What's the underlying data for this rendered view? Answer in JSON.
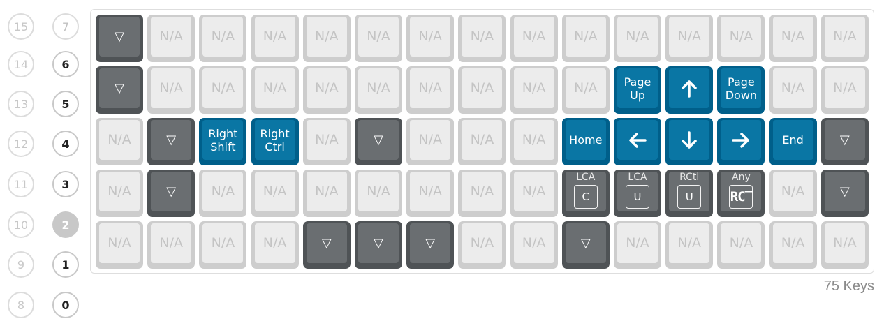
{
  "layers_left": [
    {
      "label": "15",
      "state": "inactive"
    },
    {
      "label": "14",
      "state": "inactive"
    },
    {
      "label": "13",
      "state": "inactive"
    },
    {
      "label": "12",
      "state": "inactive"
    },
    {
      "label": "11",
      "state": "inactive"
    },
    {
      "label": "10",
      "state": "inactive"
    },
    {
      "label": "9",
      "state": "inactive"
    },
    {
      "label": "8",
      "state": "inactive"
    }
  ],
  "layers_right": [
    {
      "label": "7",
      "state": "empty"
    },
    {
      "label": "6",
      "state": "used"
    },
    {
      "label": "5",
      "state": "used"
    },
    {
      "label": "4",
      "state": "used"
    },
    {
      "label": "3",
      "state": "used"
    },
    {
      "label": "2",
      "state": "active"
    },
    {
      "label": "1",
      "state": "used"
    },
    {
      "label": "0",
      "state": "used"
    }
  ],
  "keyboard": {
    "rows": [
      [
        {
          "type": "trans",
          "label": "▽"
        },
        {
          "type": "na",
          "label": "N/A"
        },
        {
          "type": "na",
          "label": "N/A"
        },
        {
          "type": "na",
          "label": "N/A"
        },
        {
          "type": "na",
          "label": "N/A"
        },
        {
          "type": "na",
          "label": "N/A"
        },
        {
          "type": "na",
          "label": "N/A"
        },
        {
          "type": "na",
          "label": "N/A"
        },
        {
          "type": "na",
          "label": "N/A"
        },
        {
          "type": "na",
          "label": "N/A"
        },
        {
          "type": "na",
          "label": "N/A"
        },
        {
          "type": "na",
          "label": "N/A"
        },
        {
          "type": "na",
          "label": "N/A"
        },
        {
          "type": "na",
          "label": "N/A"
        },
        {
          "type": "na",
          "label": "N/A"
        }
      ],
      [
        {
          "type": "trans",
          "label": "▽"
        },
        {
          "type": "na",
          "label": "N/A"
        },
        {
          "type": "na",
          "label": "N/A"
        },
        {
          "type": "na",
          "label": "N/A"
        },
        {
          "type": "na",
          "label": "N/A"
        },
        {
          "type": "na",
          "label": "N/A"
        },
        {
          "type": "na",
          "label": "N/A"
        },
        {
          "type": "na",
          "label": "N/A"
        },
        {
          "type": "na",
          "label": "N/A"
        },
        {
          "type": "na",
          "label": "N/A"
        },
        {
          "type": "blue",
          "lines": [
            "Page",
            "Up"
          ]
        },
        {
          "type": "arrow",
          "icon": "arrow-up-icon"
        },
        {
          "type": "blue",
          "lines": [
            "Page",
            "Down"
          ]
        },
        {
          "type": "na",
          "label": "N/A"
        },
        {
          "type": "na",
          "label": "N/A"
        }
      ],
      [
        {
          "type": "na",
          "label": "N/A"
        },
        {
          "type": "trans",
          "label": "▽"
        },
        {
          "type": "blue",
          "lines": [
            "Right",
            "Shift"
          ]
        },
        {
          "type": "blue",
          "lines": [
            "Right",
            "Ctrl"
          ]
        },
        {
          "type": "na",
          "label": "N/A"
        },
        {
          "type": "trans",
          "label": "▽"
        },
        {
          "type": "na",
          "label": "N/A"
        },
        {
          "type": "na",
          "label": "N/A"
        },
        {
          "type": "na",
          "label": "N/A"
        },
        {
          "type": "blue",
          "lines": [
            "Home"
          ]
        },
        {
          "type": "arrow",
          "icon": "arrow-left-icon"
        },
        {
          "type": "arrow",
          "icon": "arrow-down-icon"
        },
        {
          "type": "arrow",
          "icon": "arrow-right-icon"
        },
        {
          "type": "blue",
          "lines": [
            "End"
          ]
        },
        {
          "type": "trans",
          "label": "▽"
        }
      ],
      [
        {
          "type": "na",
          "label": "N/A"
        },
        {
          "type": "trans",
          "label": "▽"
        },
        {
          "type": "na",
          "label": "N/A"
        },
        {
          "type": "na",
          "label": "N/A"
        },
        {
          "type": "na",
          "label": "N/A"
        },
        {
          "type": "na",
          "label": "N/A"
        },
        {
          "type": "na",
          "label": "N/A"
        },
        {
          "type": "na",
          "label": "N/A"
        },
        {
          "type": "na",
          "label": "N/A"
        },
        {
          "type": "mod",
          "top": "LCA",
          "inner": "C"
        },
        {
          "type": "mod",
          "top": "LCA",
          "inner": "U"
        },
        {
          "type": "mod",
          "top": "RCtl",
          "inner": "U"
        },
        {
          "type": "mod",
          "top": "Any",
          "inner": "RC‾",
          "rc": true
        },
        {
          "type": "na",
          "label": "N/A"
        },
        {
          "type": "trans",
          "label": "▽"
        }
      ],
      [
        {
          "type": "na",
          "label": "N/A"
        },
        {
          "type": "na",
          "label": "N/A"
        },
        {
          "type": "na",
          "label": "N/A"
        },
        {
          "type": "na",
          "label": "N/A"
        },
        {
          "type": "trans",
          "label": "▽"
        },
        {
          "type": "trans",
          "label": "▽"
        },
        {
          "type": "trans",
          "label": "▽"
        },
        {
          "type": "na",
          "label": "N/A"
        },
        {
          "type": "na",
          "label": "N/A"
        },
        {
          "type": "trans",
          "label": "▽"
        },
        {
          "type": "na",
          "label": "N/A"
        },
        {
          "type": "na",
          "label": "N/A"
        },
        {
          "type": "na",
          "label": "N/A"
        },
        {
          "type": "na",
          "label": "N/A"
        },
        {
          "type": "na",
          "label": "N/A"
        }
      ]
    ]
  },
  "footer": {
    "keys_count": "75 Keys"
  },
  "colors": {
    "blue_key": "#0a76a4",
    "transparent_key": "#6a6e71",
    "na_key": "#ececec"
  }
}
